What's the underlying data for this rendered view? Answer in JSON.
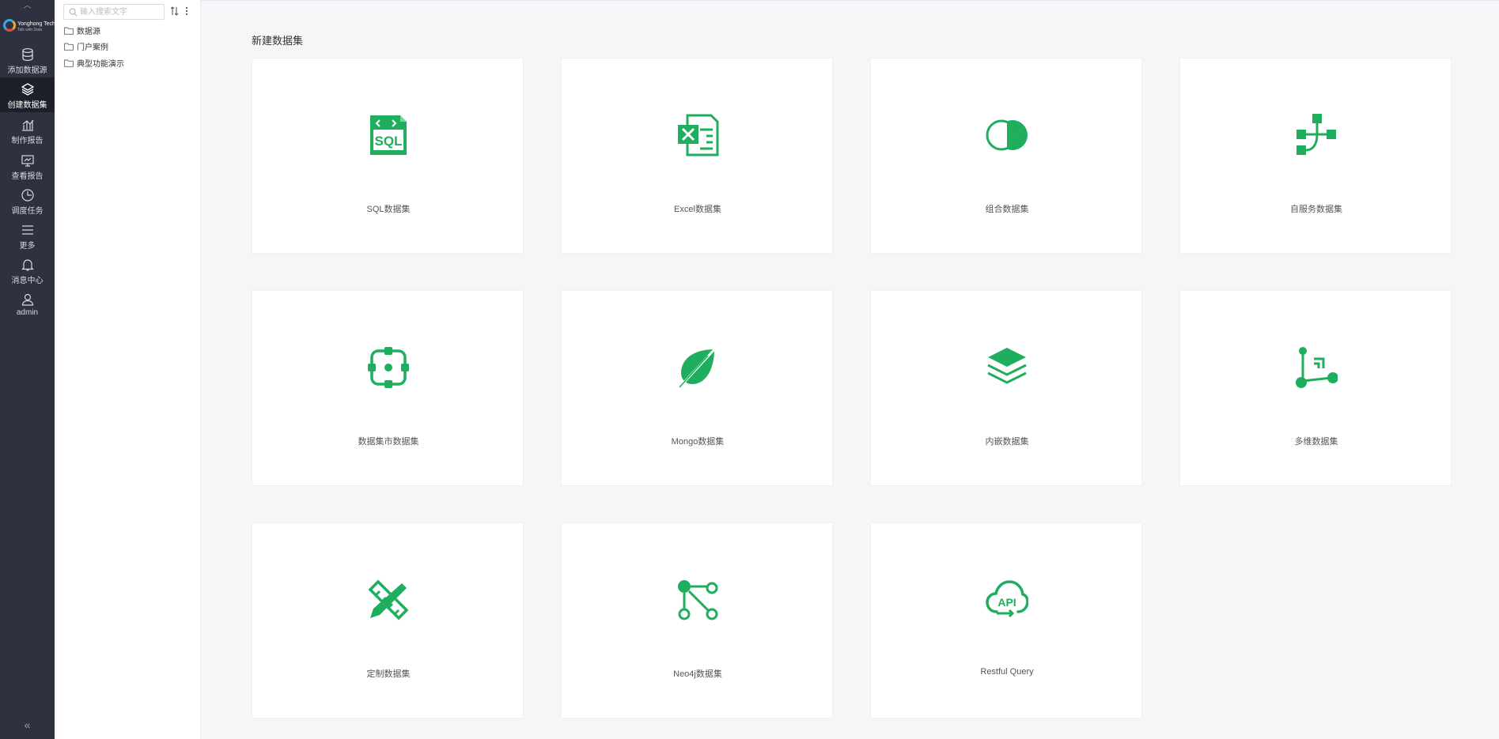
{
  "nav": {
    "logo_text": "Yonghong Tech",
    "logo_sub": "Talk with Data",
    "items": [
      {
        "label": "添加数据源"
      },
      {
        "label": "创建数据集"
      },
      {
        "label": "制作报告"
      },
      {
        "label": "查看报告"
      },
      {
        "label": "调度任务"
      },
      {
        "label": "更多"
      },
      {
        "label": "消息中心"
      },
      {
        "label": "admin"
      }
    ],
    "active_index": 1,
    "collapse_glyph": "«"
  },
  "tree": {
    "search_placeholder": "输入搜索文字",
    "items": [
      {
        "label": "数据源"
      },
      {
        "label": "门户案例"
      },
      {
        "label": "典型功能演示"
      }
    ]
  },
  "main": {
    "title": "新建数据集",
    "cards": [
      {
        "label": "SQL数据集",
        "icon": "sql-file-icon"
      },
      {
        "label": "Excel数据集",
        "icon": "excel-file-icon"
      },
      {
        "label": "组合数据集",
        "icon": "combine-circles-icon"
      },
      {
        "label": "自服务数据集",
        "icon": "flow-nodes-icon"
      },
      {
        "label": "数据集市数据集",
        "icon": "data-mart-icon"
      },
      {
        "label": "Mongo数据集",
        "icon": "leaf-icon"
      },
      {
        "label": "内嵌数据集",
        "icon": "layers-icon"
      },
      {
        "label": "多维数据集",
        "icon": "axis-cube-icon"
      },
      {
        "label": "定制数据集",
        "icon": "pencil-ruler-icon"
      },
      {
        "label": "Neo4j数据集",
        "icon": "graph-icon"
      },
      {
        "label": "Restful Query",
        "icon": "api-cloud-icon"
      }
    ]
  },
  "colors": {
    "accent": "#1fae5e",
    "nav_bg": "#2e3140"
  }
}
